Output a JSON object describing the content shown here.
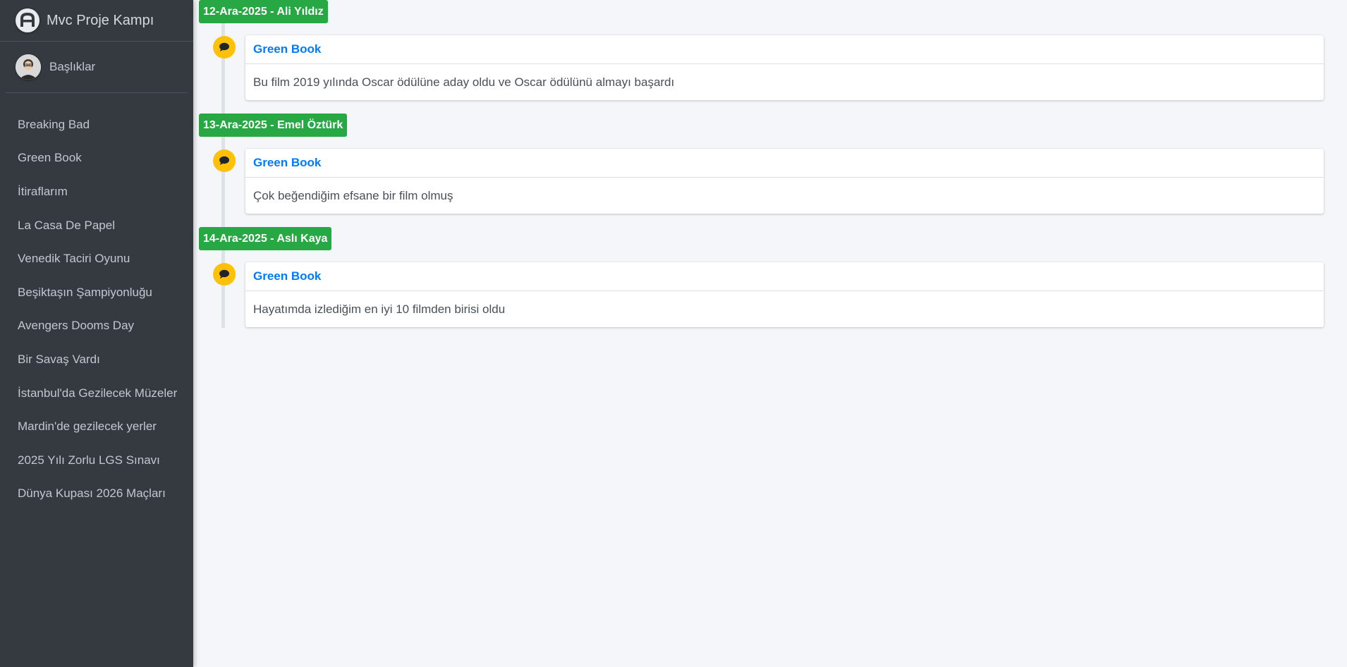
{
  "brand": {
    "title": "Mvc Proje Kampı",
    "logo_icon": "adminlte-logo-icon"
  },
  "user_panel": {
    "label": "Başlıklar",
    "avatar_icon": "user-avatar-icon"
  },
  "sidebar": {
    "items": [
      {
        "label": "Breaking Bad"
      },
      {
        "label": "Green Book"
      },
      {
        "label": "İtiraflarım"
      },
      {
        "label": "La Casa De Papel"
      },
      {
        "label": "Venedik Taciri Oyunu"
      },
      {
        "label": "Beşiktaşın Şampiyonluğu"
      },
      {
        "label": "Avengers Dooms Day"
      },
      {
        "label": "Bir Savaş Vardı"
      },
      {
        "label": "İstanbul'da Gezilecek Müzeler"
      },
      {
        "label": "Mardin'de gezilecek yerler"
      },
      {
        "label": "2025 Yılı Zorlu LGS Sınavı"
      },
      {
        "label": "Dünya Kupası 2026 Maçları"
      }
    ]
  },
  "timeline": {
    "entries": [
      {
        "label": "12-Ara-2025 - Ali Yıldız",
        "title": "Green Book",
        "body": "Bu film 2019 yılında Oscar ödülüne aday oldu ve Oscar ödülünü almayı başardı"
      },
      {
        "label": "13-Ara-2025 - Emel Öztürk",
        "title": "Green Book",
        "body": "Çok beğendiğim efsane bir film olmuş"
      },
      {
        "label": "14-Ara-2025 - Aslı Kaya",
        "title": "Green Book",
        "body": "Hayatımda izlediğim en iyi 10 filmden birisi oldu"
      }
    ]
  },
  "colors": {
    "sidebar_bg": "#343a40",
    "label_green": "#28a745",
    "icon_yellow": "#ffc107",
    "link_blue": "#007bff",
    "content_bg": "#f4f6f9"
  }
}
